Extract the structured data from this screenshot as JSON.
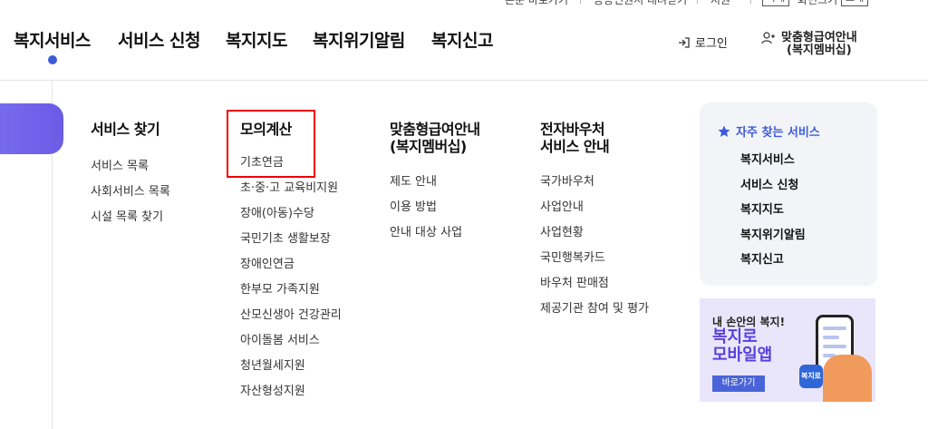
{
  "utility": {
    "items": [
      "본문 바로가기",
      "공공민원서 내려받기",
      "지원"
    ],
    "font_small": "작게",
    "font_size": "화면크기",
    "font_large": "크게"
  },
  "gnb": {
    "items": [
      "복지서비스",
      "서비스 신청",
      "복지지도",
      "복지위기알림",
      "복지신고"
    ]
  },
  "header": {
    "login": "로그인",
    "member_line1": "맞춤형급여안내",
    "member_line2": "(복지멤버십)"
  },
  "menu": {
    "col1": {
      "title": "서비스 찾기",
      "items": [
        "서비스 목록",
        "사회서비스 목록",
        "시설 목록 찾기"
      ]
    },
    "col2": {
      "title": "모의계산",
      "items": [
        "기초연금",
        "초·중·고 교육비지원",
        "장애(아동)수당",
        "국민기초 생활보장",
        "장애인연금",
        "한부모 가족지원",
        "산모신생아 건강관리",
        "아이돌봄 서비스",
        "청년월세지원",
        "자산형성지원"
      ]
    },
    "col3": {
      "title_line1": "맞춤형급여안내",
      "title_line2": "(복지멤버십)",
      "items": [
        "제도 안내",
        "이용 방법",
        "안내 대상 사업"
      ]
    },
    "col4": {
      "title_line1": "전자바우처",
      "title_line2": "서비스 안내",
      "items": [
        "국가바우처",
        "사업안내",
        "사업현황",
        "국민행복카드",
        "바우처 판매점",
        "제공기관 참여 및 평가"
      ]
    }
  },
  "favorites": {
    "title": "자주 찾는 서비스",
    "items": [
      "복지서비스",
      "서비스 신청",
      "복지지도",
      "복지위기알림",
      "복지신고"
    ]
  },
  "banner": {
    "line1": "내 손안의 복지!",
    "line2": "복지로",
    "line3": "모바일앱",
    "button": "바로가기",
    "app_label": "복지로"
  },
  "colors": {
    "accent": "#3d5bd9",
    "purple": "#6b5be6",
    "highlight": "#e00000"
  }
}
